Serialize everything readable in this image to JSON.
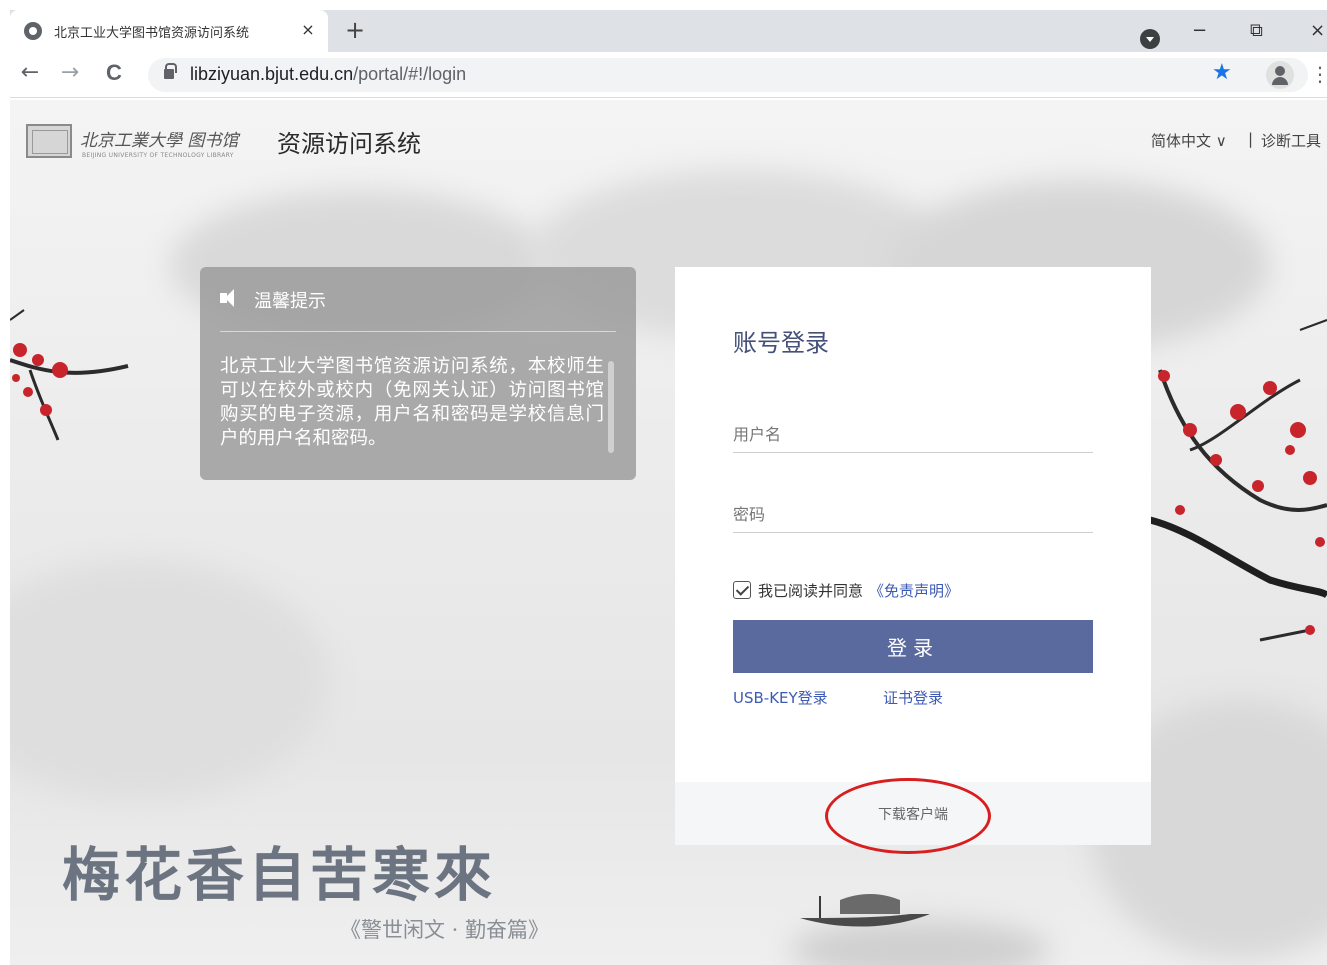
{
  "browser": {
    "tab_title": "北京工业大学图书馆资源访问系统",
    "tab_close": "×",
    "new_tab": "+",
    "back": "←",
    "forward": "→",
    "reload": "C",
    "url_host": "libziyuan.bjut.edu.cn",
    "url_path": "/portal/#!/login",
    "bookmark_star": "★",
    "menu": "⋮",
    "minimize": "−",
    "restore": "⧉",
    "close": "×"
  },
  "header": {
    "logo_text": "北京工業大學 图书馆",
    "logo_subtitle": "BEIJING UNIVERSITY OF TECHNOLOGY LIBRARY",
    "system_title": "资源访问系统",
    "language": "简体中文 ∨",
    "divider": "|",
    "diagnostics": "诊断工具"
  },
  "notice": {
    "title": "温馨提示",
    "body": "北京工业大学图书馆资源访问系统，本校师生可以在校外或校内（免网关认证）访问图书馆购买的电子资源，用户名和密码是学校信息门户的用户名和密码。"
  },
  "login": {
    "title": "账号登录",
    "username_placeholder": "用户名",
    "password_placeholder": "密码",
    "agree_text": "我已阅读并同意",
    "disclaimer_link": "《免责声明》",
    "agree_checked": true,
    "login_button": "登录",
    "usb_key_login": "USB-KEY登录",
    "cert_login": "证书登录",
    "download_client": "下载客户端"
  },
  "decoration": {
    "calligraphy": "梅花香自苦寒來",
    "calligraphy_source": "《警世闲文 · 勤奋篇》"
  },
  "colors": {
    "primary_button": "#5a6a9e",
    "link": "#3d5ab5",
    "annotation_circle": "#d81e1e",
    "blossom": "#c8242c"
  }
}
